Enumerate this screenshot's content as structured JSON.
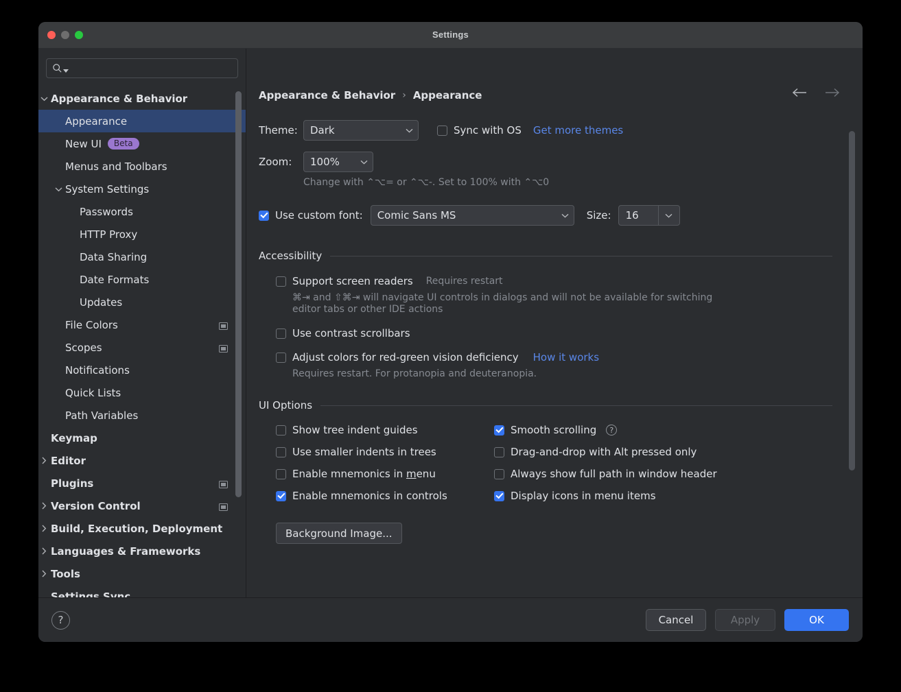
{
  "window": {
    "title": "Settings",
    "traffic_lights": [
      "close",
      "minimize",
      "zoom"
    ]
  },
  "search": {
    "value": "",
    "placeholder": ""
  },
  "sidebar": {
    "items": [
      {
        "label": "Appearance & Behavior",
        "indent": 0,
        "twisty": "down",
        "bold": true,
        "selected": false,
        "badge": "",
        "trail": ""
      },
      {
        "label": "Appearance",
        "indent": 1,
        "twisty": "",
        "bold": false,
        "selected": true,
        "badge": "",
        "trail": ""
      },
      {
        "label": "New UI",
        "indent": 1,
        "twisty": "",
        "bold": false,
        "selected": false,
        "badge": "Beta",
        "trail": ""
      },
      {
        "label": "Menus and Toolbars",
        "indent": 1,
        "twisty": "",
        "bold": false,
        "selected": false,
        "badge": "",
        "trail": ""
      },
      {
        "label": "System Settings",
        "indent": 1,
        "twisty": "down",
        "bold": false,
        "selected": false,
        "badge": "",
        "trail": ""
      },
      {
        "label": "Passwords",
        "indent": 2,
        "twisty": "",
        "bold": false,
        "selected": false,
        "badge": "",
        "trail": ""
      },
      {
        "label": "HTTP Proxy",
        "indent": 2,
        "twisty": "",
        "bold": false,
        "selected": false,
        "badge": "",
        "trail": ""
      },
      {
        "label": "Data Sharing",
        "indent": 2,
        "twisty": "",
        "bold": false,
        "selected": false,
        "badge": "",
        "trail": ""
      },
      {
        "label": "Date Formats",
        "indent": 2,
        "twisty": "",
        "bold": false,
        "selected": false,
        "badge": "",
        "trail": ""
      },
      {
        "label": "Updates",
        "indent": 2,
        "twisty": "",
        "bold": false,
        "selected": false,
        "badge": "",
        "trail": ""
      },
      {
        "label": "File Colors",
        "indent": 1,
        "twisty": "",
        "bold": false,
        "selected": false,
        "badge": "",
        "trail": "project-scope-icon"
      },
      {
        "label": "Scopes",
        "indent": 1,
        "twisty": "",
        "bold": false,
        "selected": false,
        "badge": "",
        "trail": "project-scope-icon"
      },
      {
        "label": "Notifications",
        "indent": 1,
        "twisty": "",
        "bold": false,
        "selected": false,
        "badge": "",
        "trail": ""
      },
      {
        "label": "Quick Lists",
        "indent": 1,
        "twisty": "",
        "bold": false,
        "selected": false,
        "badge": "",
        "trail": ""
      },
      {
        "label": "Path Variables",
        "indent": 1,
        "twisty": "",
        "bold": false,
        "selected": false,
        "badge": "",
        "trail": ""
      },
      {
        "label": "Keymap",
        "indent": 0,
        "twisty": "",
        "bold": true,
        "selected": false,
        "badge": "",
        "trail": ""
      },
      {
        "label": "Editor",
        "indent": 0,
        "twisty": "right",
        "bold": true,
        "selected": false,
        "badge": "",
        "trail": ""
      },
      {
        "label": "Plugins",
        "indent": 0,
        "twisty": "",
        "bold": true,
        "selected": false,
        "badge": "",
        "trail": "project-scope-icon"
      },
      {
        "label": "Version Control",
        "indent": 0,
        "twisty": "right",
        "bold": true,
        "selected": false,
        "badge": "",
        "trail": "project-scope-icon"
      },
      {
        "label": "Build, Execution, Deployment",
        "indent": 0,
        "twisty": "right",
        "bold": true,
        "selected": false,
        "badge": "",
        "trail": ""
      },
      {
        "label": "Languages & Frameworks",
        "indent": 0,
        "twisty": "right",
        "bold": true,
        "selected": false,
        "badge": "",
        "trail": ""
      },
      {
        "label": "Tools",
        "indent": 0,
        "twisty": "right",
        "bold": true,
        "selected": false,
        "badge": "",
        "trail": ""
      },
      {
        "label": "Settings Sync",
        "indent": 0,
        "twisty": "",
        "bold": true,
        "selected": false,
        "badge": "",
        "trail": ""
      }
    ]
  },
  "main": {
    "breadcrumb": {
      "parent": "Appearance & Behavior",
      "separator": "›",
      "current": "Appearance"
    },
    "nav": {
      "back": "←",
      "forward": "→"
    },
    "theme": {
      "label": "Theme:",
      "value": "Dark",
      "sync_label": "Sync with OS",
      "sync_checked": false,
      "get_more_link": "Get more themes"
    },
    "zoom": {
      "label": "Zoom:",
      "value": "100%",
      "hint": "Change with ⌃⌥= or ⌃⌥-. Set to 100% with ⌃⌥0"
    },
    "custom_font": {
      "checked": true,
      "label": "Use custom font:",
      "value": "Comic Sans MS",
      "size_label": "Size:",
      "size_value": "16"
    },
    "accessibility": {
      "title": "Accessibility",
      "screen_readers": {
        "checked": false,
        "label": "Support screen readers",
        "note": "Requires restart",
        "hint_line1": "⌘⇥ and ⇧⌘⇥ will navigate UI controls in dialogs and will not be available for switching",
        "hint_line2": "editor tabs or other IDE actions"
      },
      "contrast_scrollbars": {
        "checked": false,
        "label": "Use contrast scrollbars"
      },
      "color_deficiency": {
        "checked": false,
        "label": "Adjust colors for red-green vision deficiency",
        "link": "How it works",
        "hint": "Requires restart. For protanopia and deuteranopia."
      }
    },
    "ui_options": {
      "title": "UI Options",
      "left": [
        {
          "checked": false,
          "label": "Show tree indent guides",
          "mnemonic": ""
        },
        {
          "checked": false,
          "label": "Use smaller indents in trees",
          "mnemonic": ""
        },
        {
          "checked": false,
          "label": "Enable mnemonics in menu",
          "mnemonic": "m"
        },
        {
          "checked": true,
          "label": "Enable mnemonics in controls",
          "mnemonic": ""
        }
      ],
      "right": [
        {
          "checked": true,
          "label": "Smooth scrolling",
          "help": true
        },
        {
          "checked": false,
          "label": "Drag-and-drop with Alt pressed only",
          "help": false
        },
        {
          "checked": false,
          "label": "Always show full path in window header",
          "help": false
        },
        {
          "checked": true,
          "label": "Display icons in menu items",
          "help": false
        }
      ],
      "background_button": "Background Image..."
    }
  },
  "footer": {
    "help": "?",
    "cancel": "Cancel",
    "apply": "Apply",
    "ok": "OK"
  },
  "colors": {
    "window_bg": "#2b2d30",
    "selection": "#2f4673",
    "accent": "#3574f0",
    "link": "#5a87e8",
    "badge": "#9a77cf",
    "hint_text": "#868a91"
  }
}
